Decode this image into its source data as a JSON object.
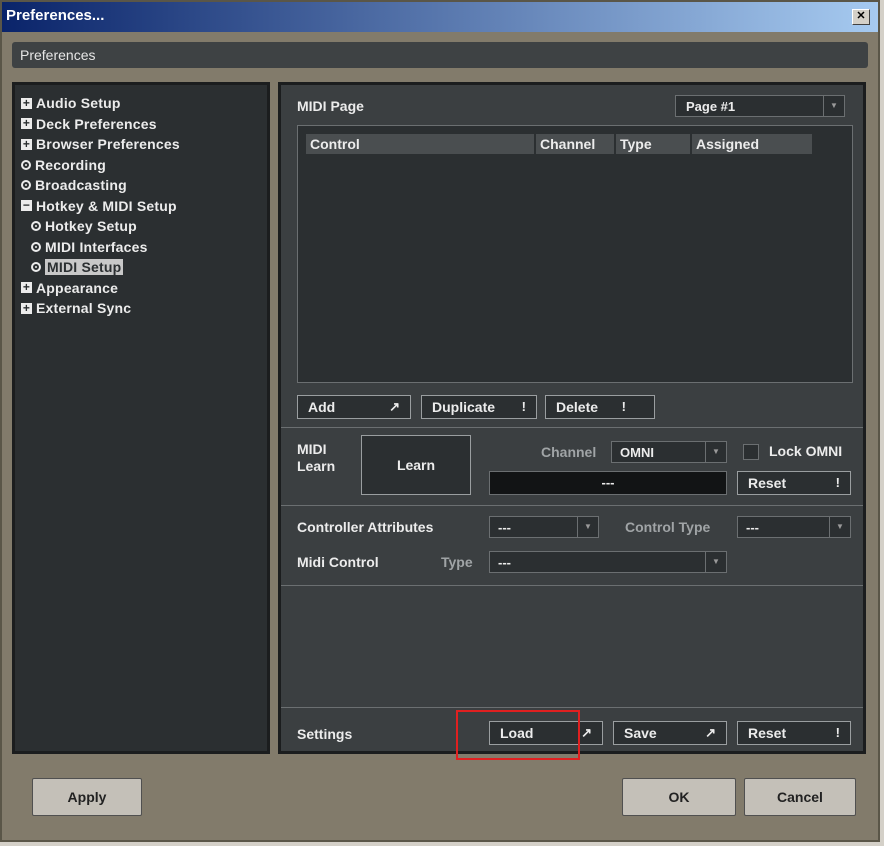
{
  "window": {
    "title": "Preferences...",
    "close_glyph": "✕"
  },
  "header": {
    "title": "Preferences"
  },
  "tree": [
    {
      "label": "Audio Setup",
      "marker": "+",
      "level": 0
    },
    {
      "label": "Deck Preferences",
      "marker": "+",
      "level": 0
    },
    {
      "label": "Browser Preferences",
      "marker": "+",
      "level": 0
    },
    {
      "label": "Recording",
      "marker": "o",
      "level": 0
    },
    {
      "label": "Broadcasting",
      "marker": "o",
      "level": 0
    },
    {
      "label": "Hotkey & MIDI Setup",
      "marker": "-",
      "level": 0
    },
    {
      "label": "Hotkey Setup",
      "marker": "o",
      "level": 1
    },
    {
      "label": "MIDI Interfaces",
      "marker": "o",
      "level": 1
    },
    {
      "label": "MIDI Setup",
      "marker": "o",
      "level": 1,
      "selected": true
    },
    {
      "label": "Appearance",
      "marker": "+",
      "level": 0
    },
    {
      "label": "External Sync",
      "marker": "+",
      "level": 0
    }
  ],
  "midi_page": {
    "label": "MIDI Page",
    "page_select": "Page #1",
    "columns": [
      "Control",
      "Channel",
      "Type",
      "Assigned"
    ],
    "buttons": {
      "add": "Add",
      "add_symbol": "↗",
      "duplicate": "Duplicate",
      "duplicate_symbol": "!",
      "delete": "Delete",
      "delete_symbol": "!"
    }
  },
  "midi_learn": {
    "label": "MIDI",
    "label2": "Learn",
    "learn_button": "Learn",
    "channel_label": "Channel",
    "channel_value": "OMNI",
    "lock_omni_label": "Lock OMNI",
    "display_value": "---",
    "reset_button": "Reset",
    "reset_symbol": "!"
  },
  "controller": {
    "attributes_label": "Controller Attributes",
    "attributes_value": "---",
    "control_type_label": "Control Type",
    "control_type_value": "---",
    "midi_control_label": "Midi Control",
    "type_label": "Type",
    "type_value": "---"
  },
  "settings": {
    "label": "Settings",
    "load": "Load",
    "load_symbol": "↗",
    "save": "Save",
    "save_symbol": "↗",
    "reset": "Reset",
    "reset_symbol": "!"
  },
  "footer": {
    "apply": "Apply",
    "ok": "OK",
    "cancel": "Cancel"
  },
  "dropdown_arrow": "▼"
}
